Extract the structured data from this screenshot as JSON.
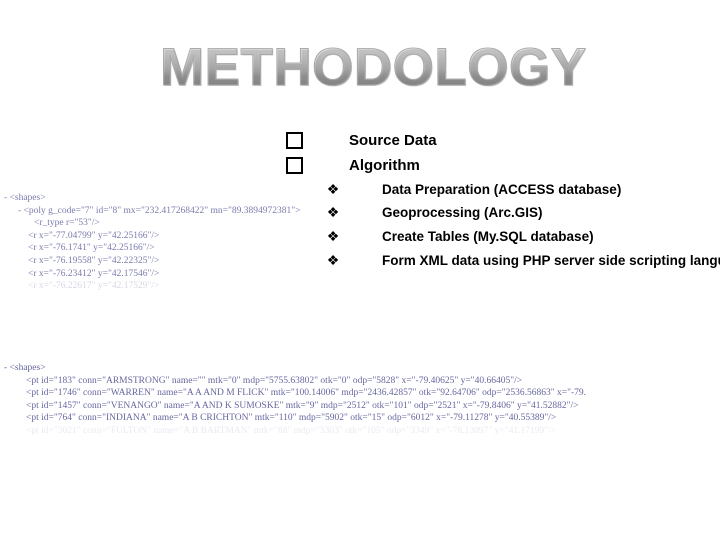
{
  "slide": {
    "title": "METHODOLOGY",
    "title_color": "#9a9a9a"
  },
  "outline": {
    "level1": [
      {
        "bullet": "hollow-square",
        "label": "Source Data"
      },
      {
        "bullet": "hollow-square",
        "label": "Algorithm"
      }
    ],
    "level2": [
      {
        "bullet": "diamond",
        "label": "Data Preparation (ACCESS database)"
      },
      {
        "bullet": "diamond",
        "label": "Geoprocessing (Arc.GIS)"
      },
      {
        "bullet": "diamond",
        "label": "Create Tables (My.SQL database)"
      },
      {
        "bullet": "diamond",
        "label": "Form XML data using PHP server side scripting language"
      }
    ]
  },
  "xml_poly": {
    "lines": [
      "- <shapes>",
      "-  <poly g_code=\"7\" id=\"8\" mx=\"232.417268422\" mn=\"89.3894972381\">",
      "<r_type r=\"53\"/>",
      "<r x=\"-77.04799\" y=\"42.25166\"/>",
      "<r x=\"-76.1741\" y=\"42.25166\"/>",
      "<r x=\"-76.19558\" y=\"42.22325\"/>",
      "<r x=\"-76.23412\" y=\"42.17546\"/>",
      "<r x=\"-76.22617\" y=\"42.17529\"/>"
    ]
  },
  "xml_pt": {
    "lines": [
      "- <shapes>",
      "<pt id=\"183\" conn=\"ARMSTRONG\" name=\"\" mtk=\"0\" mdp=\"5755.63802\" otk=\"0\" odp=\"5828\" x=\"-79.40625\" y=\"40.66405\"/>",
      "<pt id=\"1746\" conn=\"WARREN\" name=\"A A AND M FLICK\" mtk=\"100.14006\" mdp=\"2436.42857\" otk=\"92.64706\" odp=\"2536.56863\" x=\"-79.",
      "<pt id=\"1457\" conn=\"VENANGO\" name=\"A AND K SUMOSKE\" mtk=\"9\" mdp=\"2512\" otk=\"101\" odp=\"2521\" x=\"-79.8406\" y=\"41.52882\"/>",
      "<pt id=\"764\" conn=\"INDIANA\" name=\"A B CRICHTON\" mtk=\"110\" mdp=\"5902\" otk=\"15\" odp=\"6012\" x=\"-79.11278\" y=\"40.55389\"/>",
      "<pt id=\"3021\" conn=\"FULTON\" name=\"A B BARTMAN\" mtk=\"88\" mdp=\"3303\" otk=\"105\" odp=\"3349\" x=\"-78.13097\" y=\"41.17199\"/>"
    ]
  }
}
